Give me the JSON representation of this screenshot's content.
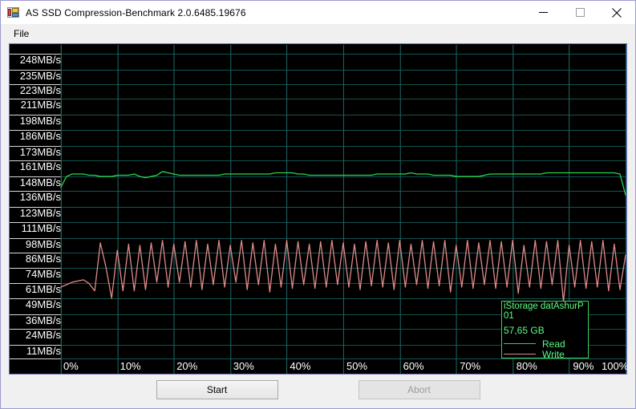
{
  "window": {
    "title": "AS SSD Compression-Benchmark 2.0.6485.19676",
    "icon": "app-window-icon",
    "minimize_label": "–",
    "maximize_label": "□",
    "close_label": "✕"
  },
  "menu": {
    "items": [
      {
        "label": "File"
      }
    ]
  },
  "buttons": {
    "start": "Start",
    "abort": "Abort"
  },
  "legend": {
    "device": "iStorage datAshurP",
    "device_line2": "01",
    "capacity": "57,65 GB",
    "read_label": "Read",
    "write_label": "Write",
    "read_color": "#29d64f",
    "write_color": "#e08a8a",
    "border_color": "#35d35f",
    "text_color": "#5efc82"
  },
  "chart_data": {
    "type": "line",
    "title": "AS SSD Compression-Benchmark",
    "xlabel": "",
    "ylabel": "",
    "grid": true,
    "background": "#000000",
    "grid_color": "#12534f",
    "grid_color_major": "#1b6b66",
    "legend_position": "bottom-right",
    "ylim": [
      0,
      255
    ],
    "xlim": [
      0,
      100
    ],
    "ytick_labels": [
      "248MB/s",
      "235MB/s",
      "223MB/s",
      "211MB/s",
      "198MB/s",
      "186MB/s",
      "173MB/s",
      "161MB/s",
      "148MB/s",
      "136MB/s",
      "123MB/s",
      "111MB/s",
      "98MB/s",
      "86MB/s",
      "74MB/s",
      "61MB/s",
      "49MB/s",
      "36MB/s",
      "24MB/s",
      "11MB/s"
    ],
    "ytick_values": [
      248,
      235,
      223,
      211,
      198,
      186,
      173,
      161,
      148,
      136,
      123,
      111,
      98,
      86,
      74,
      61,
      49,
      36,
      24,
      11
    ],
    "xtick_labels": [
      "0%",
      "10%",
      "20%",
      "30%",
      "40%",
      "50%",
      "60%",
      "70%",
      "80%",
      "90%",
      "100%"
    ],
    "xtick_values": [
      0,
      10,
      20,
      30,
      40,
      50,
      60,
      70,
      80,
      90,
      100
    ],
    "x": [
      0,
      1,
      2,
      3,
      4,
      5,
      6,
      7,
      8,
      9,
      10,
      11,
      12,
      13,
      14,
      15,
      16,
      17,
      18,
      19,
      20,
      21,
      22,
      23,
      24,
      25,
      26,
      27,
      28,
      29,
      30,
      31,
      32,
      33,
      34,
      35,
      36,
      37,
      38,
      39,
      40,
      41,
      42,
      43,
      44,
      45,
      46,
      47,
      48,
      49,
      50,
      51,
      52,
      53,
      54,
      55,
      56,
      57,
      58,
      59,
      60,
      61,
      62,
      63,
      64,
      65,
      66,
      67,
      68,
      69,
      70,
      71,
      72,
      73,
      74,
      75,
      76,
      77,
      78,
      79,
      80,
      81,
      82,
      83,
      84,
      85,
      86,
      87,
      88,
      89,
      90,
      91,
      92,
      93,
      94,
      95,
      96,
      97,
      98,
      99,
      100
    ],
    "series": [
      {
        "name": "Read",
        "color": "#29d64f",
        "values": [
          139,
          148,
          150,
          150,
          150,
          149,
          149,
          148,
          148,
          148,
          149,
          149,
          149,
          150,
          148,
          147,
          148,
          149,
          152,
          151,
          150,
          149,
          149,
          149,
          149,
          149,
          149,
          149,
          149,
          150,
          150,
          150,
          150,
          150,
          150,
          150,
          150,
          150,
          151,
          151,
          151,
          151,
          150,
          150,
          149,
          149,
          149,
          149,
          149,
          149,
          149,
          149,
          149,
          149,
          149,
          149,
          150,
          150,
          150,
          150,
          150,
          150,
          151,
          150,
          150,
          150,
          149,
          149,
          149,
          149,
          148,
          148,
          148,
          148,
          148,
          149,
          150,
          150,
          150,
          150,
          150,
          150,
          150,
          150,
          150,
          150,
          151,
          151,
          151,
          151,
          151,
          151,
          151,
          151,
          151,
          151,
          151,
          151,
          151,
          150,
          133
        ]
      },
      {
        "name": "Write",
        "color": "#e08a8a",
        "values": [
          58,
          60,
          62,
          63,
          64,
          61,
          55,
          94,
          74,
          49,
          88,
          55,
          93,
          55,
          92,
          56,
          94,
          62,
          96,
          58,
          93,
          62,
          95,
          58,
          96,
          56,
          93,
          60,
          96,
          58,
          92,
          62,
          96,
          56,
          94,
          60,
          96,
          54,
          93,
          58,
          96,
          57,
          95,
          60,
          93,
          57,
          95,
          58,
          96,
          60,
          94,
          58,
          93,
          56,
          95,
          59,
          96,
          58,
          94,
          56,
          96,
          58,
          93,
          60,
          96,
          57,
          95,
          59,
          96,
          54,
          92,
          58,
          96,
          57,
          94,
          60,
          96,
          57,
          95,
          58,
          96,
          53,
          92,
          58,
          96,
          57,
          95,
          60,
          96,
          46,
          92,
          58,
          96,
          57,
          95,
          58,
          96,
          55,
          93,
          56,
          84
        ]
      }
    ]
  }
}
